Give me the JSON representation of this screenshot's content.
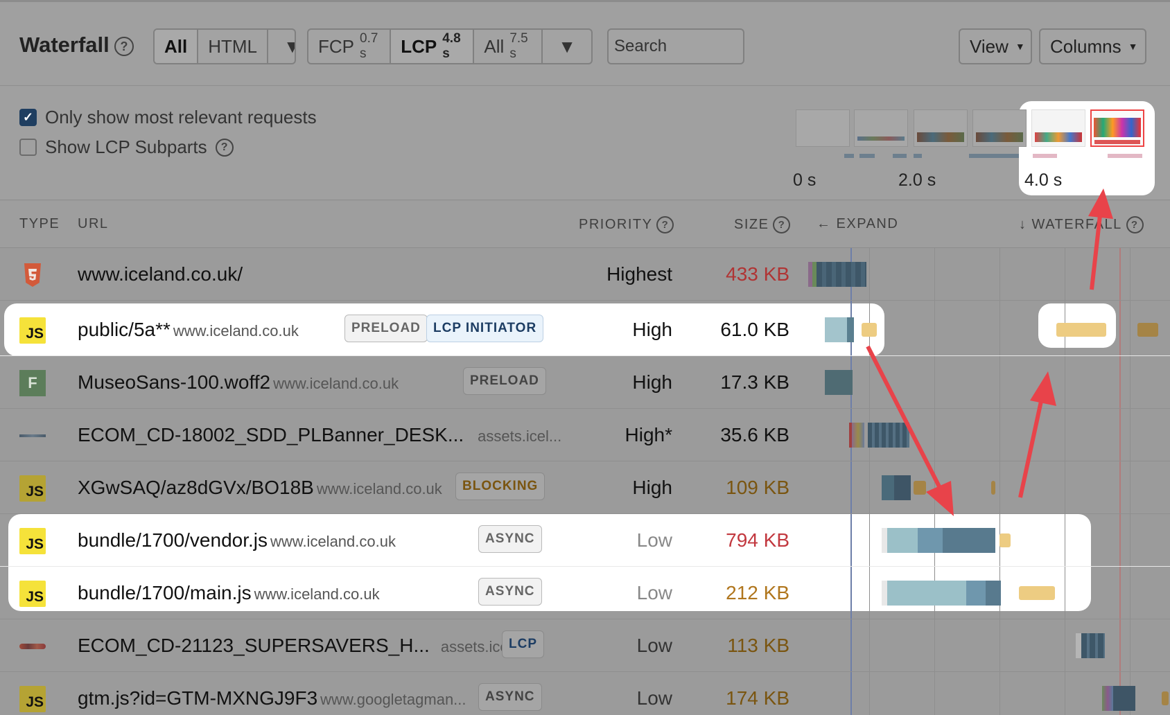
{
  "toolbar": {
    "title": "Waterfall",
    "help_icon": "question-circle-icon",
    "type_filter": {
      "all": "All",
      "html": "HTML"
    },
    "timing": {
      "fcp_label": "FCP",
      "fcp_value": "0.7 s",
      "lcp_label": "LCP",
      "lcp_value": "4.8 s",
      "all_label": "All",
      "all_value": "7.5 s"
    },
    "search_placeholder": "Search",
    "view_label": "View",
    "columns_label": "Columns"
  },
  "options": {
    "relevant_label": "Only show most relevant requests",
    "relevant_checked": true,
    "subparts_label": "Show LCP Subparts",
    "subparts_checked": false
  },
  "timeline": {
    "labels": [
      "0 s",
      "2.0 s",
      "4.0 s"
    ]
  },
  "columns": {
    "type": "TYPE",
    "url": "URL",
    "priority": "PRIORITY",
    "size": "SIZE",
    "expand": "← EXPAND",
    "waterfall": "↓ WATERFALL"
  },
  "rows": [
    {
      "type": "html",
      "type_icon": "html5-icon",
      "url": "www.iceland.co.uk/",
      "domain": "",
      "tags": [],
      "priority": "Highest",
      "size": "433 KB",
      "size_color": "#b03434"
    },
    {
      "type": "js",
      "type_icon": "js-icon",
      "url": "public/5a**",
      "domain": "www.iceland.co.uk",
      "tags": [
        "PRELOAD",
        "LCP INITIATOR"
      ],
      "priority": "High",
      "size": "61.0 KB",
      "size_color": "#111111"
    },
    {
      "type": "font",
      "type_icon": "font-icon",
      "type_letter": "F",
      "url": "MuseoSans-100.woff2",
      "domain": "www.iceland.co.uk",
      "tags": [
        "PRELOAD"
      ],
      "priority": "High",
      "size": "17.3 KB",
      "size_color": "#111111"
    },
    {
      "type": "image",
      "type_icon": "image-thumbnail-icon",
      "url": "ECOM_CD-18002_SDD_PLBanner_DESK...",
      "domain": "assets.icel...",
      "tags": [],
      "priority": "High*",
      "size": "35.6 KB",
      "size_color": "#111111"
    },
    {
      "type": "js",
      "type_icon": "js-icon",
      "url": "XGwSAQ/az8dGVx/BO18B",
      "domain": "www.iceland.co.uk",
      "tags": [
        "BLOCKING"
      ],
      "priority": "High",
      "size": "109 KB",
      "size_color": "#7a5510"
    },
    {
      "type": "js",
      "type_icon": "js-icon",
      "url": "bundle/1700/vendor.js",
      "domain": "www.iceland.co.uk",
      "tags": [
        "ASYNC"
      ],
      "priority": "Low",
      "size": "794 KB",
      "size_color": "#c2383f"
    },
    {
      "type": "js",
      "type_icon": "js-icon",
      "url": "bundle/1700/main.js",
      "domain": "www.iceland.co.uk",
      "tags": [
        "ASYNC"
      ],
      "priority": "Low",
      "size": "212 KB",
      "size_color": "#b0761d"
    },
    {
      "type": "image",
      "type_icon": "image-thumbnail-icon",
      "url": "ECOM_CD-21123_SUPERSAVERS_H...",
      "domain": "assets.ice...",
      "tags": [
        "LCP"
      ],
      "priority": "Low",
      "size": "113 KB",
      "size_color": "#7a5510"
    },
    {
      "type": "js",
      "type_icon": "js-icon",
      "url": "gtm.js?id=GTM-MXNGJ9F3",
      "domain": "www.googletagman...",
      "tags": [
        "ASYNC"
      ],
      "priority": "Low",
      "size": "174 KB",
      "size_color": "#7a5510"
    }
  ],
  "colors": {
    "highlight": "#ffffff",
    "arrow": "#e8434a",
    "js_yellow": "#f5e23a",
    "checkbox": "#1f3e60"
  }
}
